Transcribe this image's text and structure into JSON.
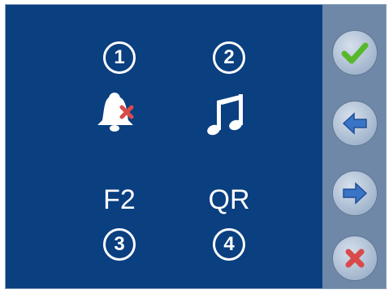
{
  "tiles": [
    {
      "number": "1",
      "icon": "bell-muted-icon",
      "label": ""
    },
    {
      "number": "2",
      "icon": "music-note-icon",
      "label": ""
    },
    {
      "number": "3",
      "icon": "",
      "label": "F2"
    },
    {
      "number": "4",
      "icon": "",
      "label": "QR"
    }
  ],
  "sidebar": {
    "buttons": [
      {
        "icon": "check-icon"
      },
      {
        "icon": "arrow-left-icon"
      },
      {
        "icon": "arrow-right-icon"
      },
      {
        "icon": "close-icon"
      }
    ]
  },
  "colors": {
    "background": "#0a3f80",
    "sidebar": "#6f88a8",
    "check": "#57b92a",
    "arrow": "#3a74c6",
    "close": "#d94a4a"
  }
}
